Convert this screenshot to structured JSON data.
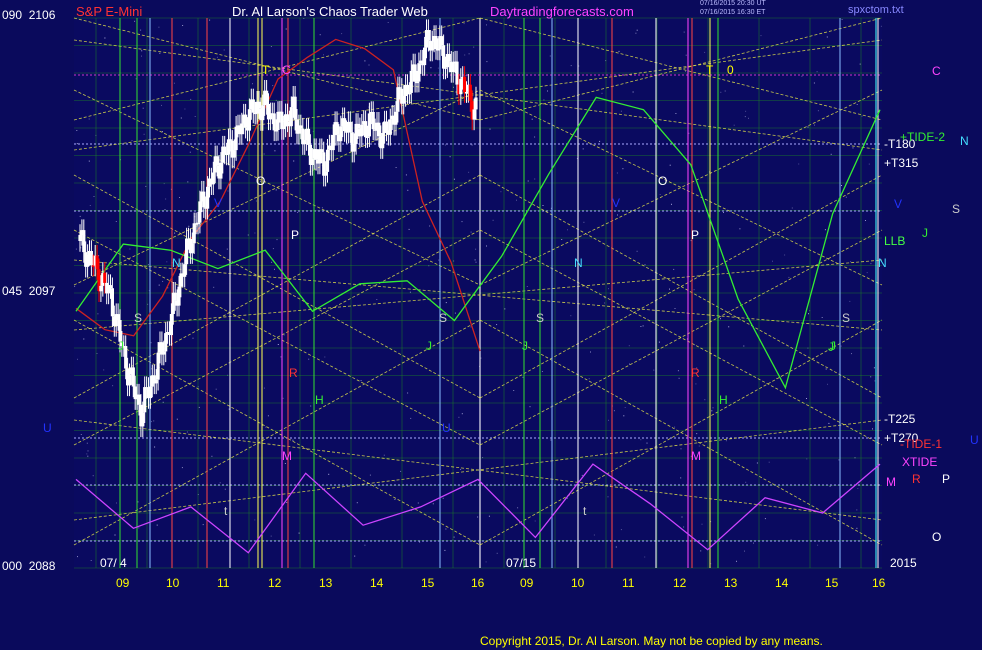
{
  "header": {
    "instrument": "S&P E-Mini",
    "title": "Dr. Al Larson's Chaos Trader Web",
    "site": "Daytradingforecasts.com",
    "timestamp1": "07/16/2015 20:30 UT",
    "timestamp2": "07/16/2015 16:30 ET",
    "file": "spxctom.txt"
  },
  "y_axis": [
    {
      "idx": "090",
      "price": "2106"
    },
    {
      "idx": "045",
      "price": "2097"
    },
    {
      "idx": "000",
      "price": "2088"
    }
  ],
  "date_labels": [
    "07/ 4",
    "07/15",
    "2015"
  ],
  "x_ticks_left": [
    "09",
    "10",
    "11",
    "12",
    "13",
    "14",
    "15",
    "16"
  ],
  "x_ticks_right": [
    "09",
    "10",
    "11",
    "12",
    "13",
    "14",
    "15",
    "16"
  ],
  "right_labels": [
    {
      "text": "C",
      "color": "#ff44ff"
    },
    {
      "text": "-T180",
      "color": "#ffffff"
    },
    {
      "text": "+TIDE-2",
      "color": "#33ee33"
    },
    {
      "text": "N",
      "color": "#44ddff"
    },
    {
      "text": "+T315",
      "color": "#ffffff"
    },
    {
      "text": "V",
      "color": "#2233ff"
    },
    {
      "text": "S",
      "color": "#cccccc"
    },
    {
      "text": "J",
      "color": "#33ee33"
    },
    {
      "text": "LLB",
      "color": "#44ff44"
    },
    {
      "text": "N",
      "color": "#44ddff"
    },
    {
      "text": "S",
      "color": "#cccccc"
    },
    {
      "text": "J",
      "color": "#33ee33"
    },
    {
      "text": "-T225",
      "color": "#ffffff"
    },
    {
      "text": "+T270",
      "color": "#ffffff"
    },
    {
      "text": "-TIDE-1",
      "color": "#ff3333"
    },
    {
      "text": "U",
      "color": "#2233ff"
    },
    {
      "text": "XTIDE",
      "color": "#ff44ff"
    },
    {
      "text": "M",
      "color": "#ff44ff"
    },
    {
      "text": "R",
      "color": "#ff3333"
    },
    {
      "text": "P",
      "color": "#ffffff"
    },
    {
      "text": "O",
      "color": "#ffffff"
    }
  ],
  "chart_markers": [
    {
      "text": "T",
      "color": "#ffff00"
    },
    {
      "text": "C",
      "color": "#ff44ff"
    },
    {
      "text": "T",
      "color": "#ffff00"
    },
    {
      "text": "0",
      "color": "#ffff00"
    },
    {
      "text": "O",
      "color": "#ffffff"
    },
    {
      "text": "O",
      "color": "#ffffff"
    },
    {
      "text": "P",
      "color": "#ffffff"
    },
    {
      "text": "P",
      "color": "#ffffff"
    },
    {
      "text": "N",
      "color": "#44ddff"
    },
    {
      "text": "N",
      "color": "#44ddff"
    },
    {
      "text": "S",
      "color": "#cccccc"
    },
    {
      "text": "S",
      "color": "#cccccc"
    },
    {
      "text": "S",
      "color": "#cccccc"
    },
    {
      "text": "J",
      "color": "#33ee33"
    },
    {
      "text": "J",
      "color": "#33ee33"
    },
    {
      "text": "J",
      "color": "#33ee33"
    },
    {
      "text": "J",
      "color": "#33ee33"
    },
    {
      "text": "R",
      "color": "#ff3333"
    },
    {
      "text": "R",
      "color": "#ff3333"
    },
    {
      "text": "H",
      "color": "#33ee33"
    },
    {
      "text": "H",
      "color": "#33ee33"
    },
    {
      "text": "M",
      "color": "#ff44ff"
    },
    {
      "text": "M",
      "color": "#ff44ff"
    },
    {
      "text": "t",
      "color": "#cccccc"
    },
    {
      "text": "t",
      "color": "#cccccc"
    },
    {
      "text": "V",
      "color": "#2233ff"
    },
    {
      "text": "V",
      "color": "#2233ff"
    },
    {
      "text": "U",
      "color": "#2233ff"
    },
    {
      "text": "U",
      "color": "#2233ff"
    }
  ],
  "copyright": "Copyright 2015, Dr. Al Larson. May not be copied by any means.",
  "colors": {
    "background": "#0a0a5c",
    "price_up": "#ffffff",
    "price_down": "#ff0000",
    "grid": "#1f8f1f",
    "fan_lines": "#e8e84a"
  },
  "chart_data": {
    "type": "candlestick",
    "title": "S&P E-Mini",
    "ylim": [
      2088,
      2106
    ],
    "yticks": [
      2088,
      2097,
      2106
    ],
    "xticks_left": [
      "09",
      "10",
      "11",
      "12",
      "13",
      "14",
      "15",
      "16"
    ],
    "xticks_right": [
      "09",
      "10",
      "11",
      "12",
      "13",
      "14",
      "15",
      "16"
    ],
    "price_path": [
      2098.7,
      2097.8,
      2096.9,
      2094.7,
      2093.1,
      2094.5,
      2096.2,
      2098.3,
      2099.9,
      2101.2,
      2101.9,
      2102.8,
      2103.2,
      2102.5,
      2102.9,
      2101.7,
      2101.2,
      2102.5,
      2102.1,
      2102.6,
      2102.1,
      2103.4,
      2104.1,
      2105.4,
      2104.7,
      2103.9,
      2103.0
    ],
    "lines": [
      {
        "name": "red envelope",
        "color": "#cc2222",
        "values": [
          2096.5,
          2095.8,
          2095.6,
          2096.9,
          2098.8,
          2100.0,
          2101.9,
          2104.0,
          2104.7,
          2105.3,
          2105.0,
          2104.3,
          2100.0,
          2098.0,
          2095.1
        ]
      },
      {
        "name": "green tide",
        "color": "#33ee33",
        "values": [
          2096.4,
          2098.6,
          2098.4,
          2097.8,
          2098.4,
          2096.4,
          2097.3,
          2097.4,
          2096.1,
          2098.2,
          2100.9,
          2103.4,
          2103.0,
          2101.2,
          2096.8,
          2093.9,
          2099.6,
          2103.0
        ]
      },
      {
        "name": "magenta cycle",
        "color": "#cc44ff",
        "values": [
          2090.9,
          2089.3,
          2090.0,
          2088.5,
          2091.1,
          2089.4,
          2090.0,
          2090.9,
          2089.0,
          2091.4,
          2090.1,
          2088.6,
          2090.3,
          2089.8,
          2091.4
        ]
      }
    ]
  }
}
